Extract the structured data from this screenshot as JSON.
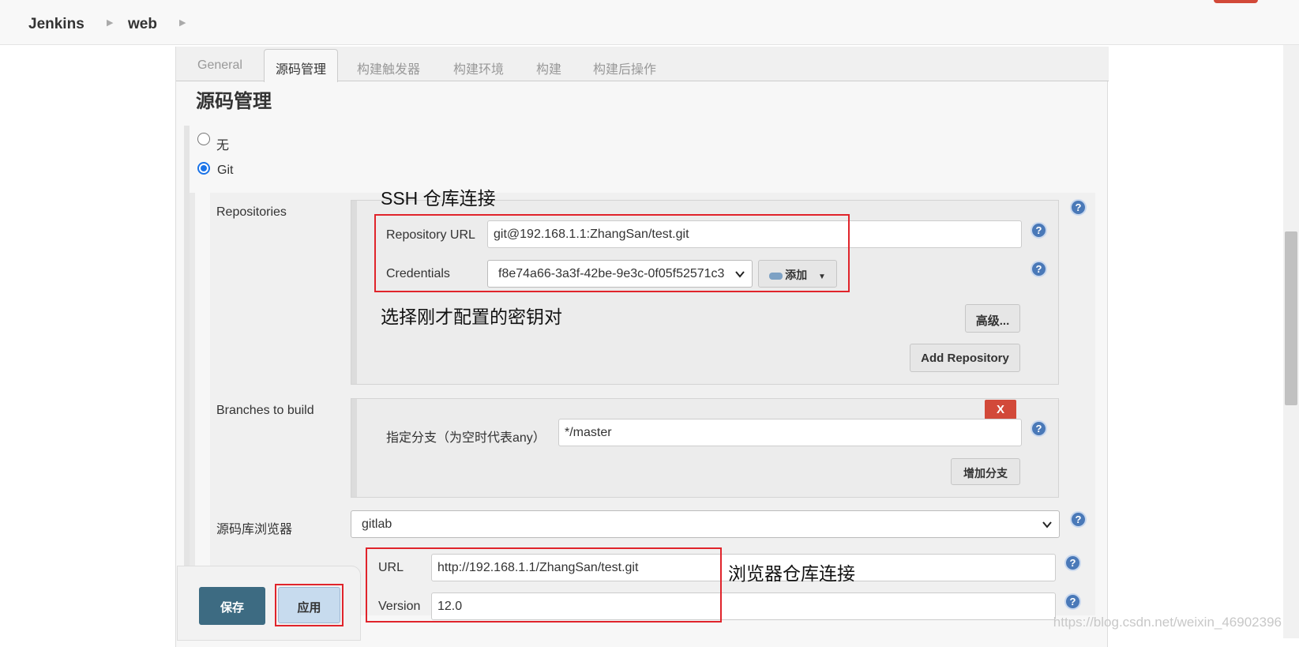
{
  "breadcrumb": {
    "root": "Jenkins",
    "job": "web"
  },
  "tabs": [
    "General",
    "源码管理",
    "构建触发器",
    "构建环境",
    "构建",
    "构建后操作"
  ],
  "active_tab_index": 1,
  "section": {
    "title": "源码管理"
  },
  "scm_options": [
    {
      "label": "无",
      "checked": false
    },
    {
      "label": "Git",
      "checked": true
    }
  ],
  "repositories": {
    "label": "Repositories",
    "url_label": "Repository URL",
    "url_value": "git@192.168.1.1:ZhangSan/test.git",
    "credentials_label": "Credentials",
    "credentials_value": "f8e74a66-3a3f-42be-9e3c-0f05f52571c3",
    "add_button": "添加",
    "advanced_button": "高级...",
    "add_repository_button": "Add Repository"
  },
  "branches": {
    "label": "Branches to build",
    "specifier_label": "指定分支（为空时代表any）",
    "specifier_value": "*/master",
    "delete_button": "X",
    "add_branch_button": "增加分支"
  },
  "browser": {
    "label": "源码库浏览器",
    "value": "gitlab",
    "url_label": "URL",
    "url_value": "http://192.168.1.1/ZhangSan/test.git",
    "version_label": "Version",
    "version_value": "12.0"
  },
  "actions": {
    "save": "保存",
    "apply": "应用"
  },
  "annotations": {
    "ssh": "SSH 仓库连接",
    "credentials": "选择刚才配置的密钥对",
    "browser": "浏览器仓库连接"
  },
  "watermark": "https://blog.csdn.net/weixin_46902396",
  "colors": {
    "annotation_border": "#e0242b",
    "save_button": "#3d6b82",
    "apply_button": "#c7dbee",
    "help_icon": "#4a79b8"
  }
}
